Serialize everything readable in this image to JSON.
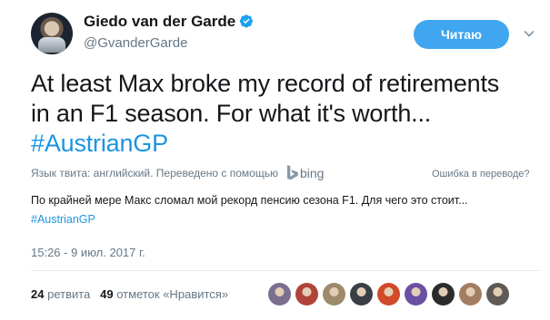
{
  "author": {
    "name": "Giedo van der Garde",
    "handle": "@GvanderGarde"
  },
  "follow_button": {
    "label": "Читаю",
    "color": "#3fa6ef"
  },
  "tweet": {
    "text_line1": "At least Max broke my record of retirements",
    "text_line2": "in an F1 season. For what it's worth...",
    "hashtag": "#AustrianGP"
  },
  "translation": {
    "info": "Язык твита: английский. Переведено с помощью",
    "provider": "bing",
    "wrong_label": "Ошибка в переводе?",
    "text": "По крайней мере Макс сломал мой рекорд пенсию сезона F1. Для чего это стоит...",
    "hashtag": "#AustrianGP"
  },
  "timestamp": "15:26 - 9 июл. 2017 г.",
  "stats": {
    "retweets_count": "24",
    "retweets_label": "ретвита",
    "likes_count": "49",
    "likes_label": "отметок «Нравится»"
  },
  "icons": [
    "verified-badge-icon",
    "chevron-down-icon",
    "bing-logo-icon"
  ],
  "colors": {
    "link": "#1b95e0",
    "muted": "#657786",
    "text": "#14171a",
    "verified": "#1da1f2"
  },
  "likers": [
    {
      "color": "#7b6f8f"
    },
    {
      "color": "#b0443a"
    },
    {
      "color": "#9c8a6a"
    },
    {
      "color": "#3a3f46"
    },
    {
      "color": "#d14a2a"
    },
    {
      "color": "#6a4fa3"
    },
    {
      "color": "#2b2b2b"
    },
    {
      "color": "#a37d62"
    },
    {
      "color": "#5f5a55"
    }
  ]
}
